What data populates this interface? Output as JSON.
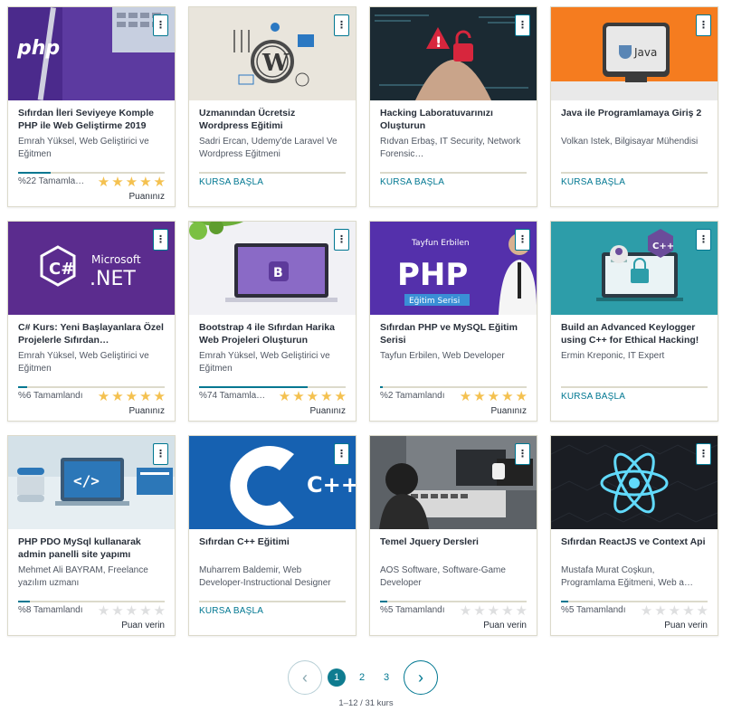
{
  "courses": [
    {
      "title": "Sıfırdan İleri Seviyeye Komple PHP ile Web Geliştirme 2019",
      "instructor": "Emrah Yüksel, Web Geliştirici ve Eğitmen",
      "progress_label": "%22 Tamamla…",
      "progress": 0.22,
      "stars": 5,
      "rating_label": "Puanınız",
      "thumb": "php-laptop"
    },
    {
      "title": "Uzmanından Ücretsiz Wordpress Eğitimi",
      "instructor": "Sadri Ercan, Udemy'de Laravel Ve Wordpress Eğitmeni",
      "cta": "KURSA BAŞLA",
      "progress": 0,
      "thumb": "wordpress"
    },
    {
      "title": "Hacking Laboratuvarınızı Oluşturun",
      "instructor": "Rıdvan Erbaş, IT Security, Network Forensic…",
      "cta": "KURSA BAŞLA",
      "progress": 0,
      "thumb": "hacking"
    },
    {
      "title": "Java ile Programlamaya Giriş 2",
      "instructor": "Volkan Istek, Bilgisayar Mühendisi",
      "cta": "KURSA BAŞLA",
      "progress": 0,
      "thumb": "java"
    },
    {
      "title": "C# Kurs: Yeni Başlayanlara Özel Projelerle Sıfırdan…",
      "instructor": "Emrah Yüksel, Web Geliştirici ve Eğitmen",
      "progress_label": "%6 Tamamlandı",
      "progress": 0.06,
      "stars": 5,
      "rating_label": "Puanınız",
      "thumb": "dotnet"
    },
    {
      "title": "Bootstrap 4 ile Sıfırdan Harika Web Projeleri Oluşturun",
      "instructor": "Emrah Yüksel, Web Geliştirici ve Eğitmen",
      "progress_label": "%74 Tamamla…",
      "progress": 0.74,
      "stars": 5,
      "rating_label": "Puanınız",
      "thumb": "bootstrap"
    },
    {
      "title": "Sıfırdan PHP ve MySQL Eğitim Serisi",
      "instructor": "Tayfun Erbilen, Web Developer",
      "progress_label": "%2 Tamamlandı",
      "progress": 0.02,
      "stars": 5,
      "rating_label": "Puanınız",
      "thumb": "php-series",
      "thumb_text": {
        "name": "Tayfun Erbilen",
        "big": "PHP",
        "sub": "Eğitim Serisi"
      }
    },
    {
      "title": "Build an Advanced Keylogger using C++ for Ethical Hacking!",
      "instructor": "Ermin Kreponic, IT Expert",
      "cta": "KURSA BAŞLA",
      "progress": 0,
      "thumb": "keylogger"
    },
    {
      "title": "PHP PDO MySql kullanarak admin panelli site yapımı",
      "instructor": "Mehmet Ali BAYRAM, Freelance yazılım uzmanı",
      "progress_label": "%8 Tamamlandı",
      "progress": 0.08,
      "stars": 0,
      "rating_label": "Puan verin",
      "thumb": "pdo"
    },
    {
      "title": "Sıfırdan C++ Eğitimi",
      "instructor": "Muharrem Baldemir, Web Developer-Instructional Designer",
      "cta": "KURSA BAŞLA",
      "progress": 0,
      "thumb": "cpp"
    },
    {
      "title": "Temel Jquery Dersleri",
      "instructor": "AOS Software, Software-Game Developer",
      "progress_label": "%5 Tamamlandı",
      "progress": 0.05,
      "stars": 0,
      "rating_label": "Puan verin",
      "thumb": "jquery"
    },
    {
      "title": "Sıfırdan ReactJS ve Context Api",
      "instructor": "Mustafa Murat Coşkun, Programlama Eğitmeni, Web a…",
      "progress_label": "%5 Tamamlandı",
      "progress": 0.05,
      "stars": 0,
      "rating_label": "Puan verin",
      "thumb": "react"
    }
  ],
  "thumb_labels": {
    "php": "php",
    "net_top": "Microsoft",
    "net_big": ".NET",
    "java": "Java",
    "cpp": "C++"
  },
  "menu_icon": "⋮",
  "pagination": {
    "prev": "‹",
    "next": "›",
    "pages": [
      "1",
      "2",
      "3"
    ],
    "active": "1",
    "count": "1–12 / 31 kurs"
  },
  "colors": {
    "accent": "#007791",
    "star": "#f4c150",
    "star_off": "#dedfe0",
    "purple": "#5b2c8e",
    "teal": "#1d8a97"
  }
}
